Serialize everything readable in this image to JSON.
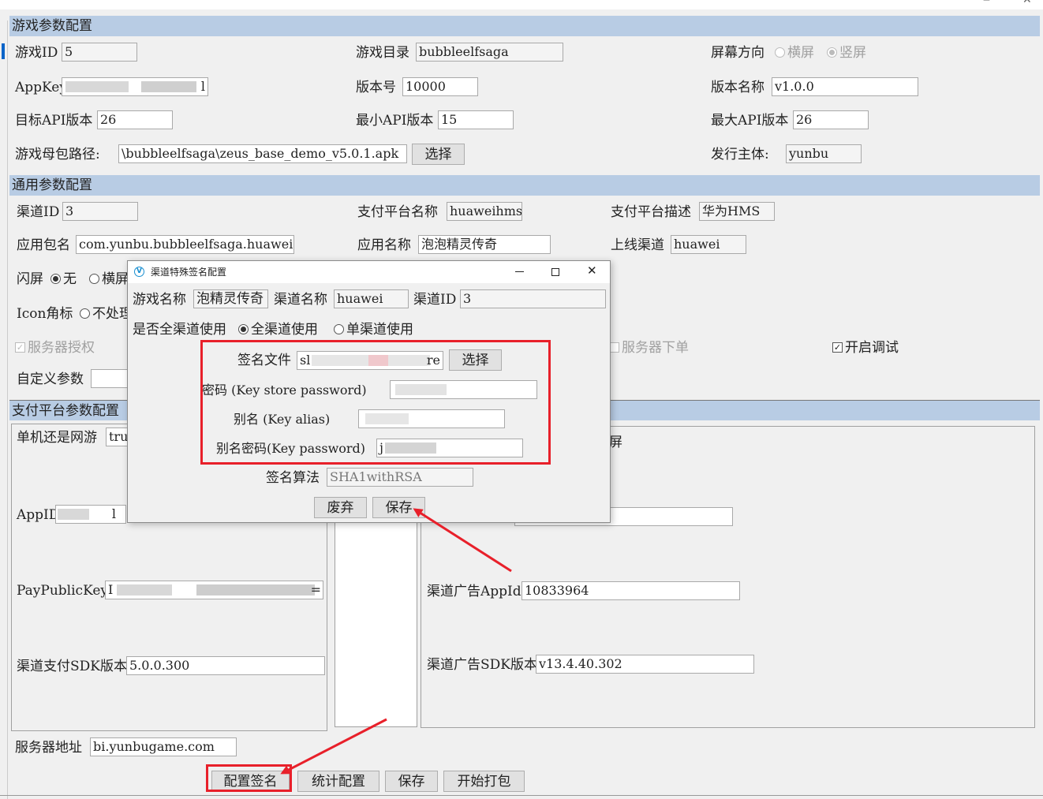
{
  "game_params": {
    "section_title": "游戏参数配置",
    "game_id_label": "游戏ID",
    "game_id": "5",
    "game_dir_label": "游戏目录",
    "game_dir": "bubbleelfsaga",
    "orientation_label": "屏幕方向",
    "orientation_landscape": "横屏",
    "orientation_portrait": "竖屏",
    "appkey_label": "AppKey",
    "appkey_tail": "l",
    "version_code_label": "版本号",
    "version_code": "10000",
    "version_name_label": "版本名称",
    "version_name": "v1.0.0",
    "target_api_label": "目标API版本",
    "target_api": "26",
    "min_api_label": "最小API版本",
    "min_api": "15",
    "max_api_label": "最大API版本",
    "max_api": "26",
    "apk_path_label": "游戏母包路径:",
    "apk_path": "\\bubbleelfsaga\\zeus_base_demo_v5.0.1.apk",
    "choose_label": "选择",
    "publisher_label": "发行主体:",
    "publisher": "yunbu"
  },
  "common_params": {
    "section_title": "通用参数配置",
    "channel_id_label": "渠道ID",
    "channel_id": "3",
    "pay_platform_name_label": "支付平台名称",
    "pay_platform_name": "huaweihms",
    "pay_platform_desc_label": "支付平台描述",
    "pay_platform_desc": "华为HMS",
    "package_label": "应用包名",
    "package": "com.yunbu.bubbleelfsaga.huawei",
    "app_name_label": "应用名称",
    "app_name": "泡泡精灵传奇",
    "online_channel_label": "上线渠道",
    "online_channel": "huawei",
    "splash_label": "闪屏",
    "splash_none": "无",
    "splash_landscape": "横屏",
    "icon_badge_label": "Icon角标",
    "icon_badge_opt": "不处理",
    "server_auth_label": "服务器授权",
    "server_order_label": "服务器下单",
    "debug_label": "开启调试",
    "custom_params_label": "自定义参数"
  },
  "pay_params": {
    "section_title": "支付平台参数配置",
    "single_or_online_label": "单机还是网游",
    "single_or_online": "tru",
    "appid_label": "AppID",
    "appid_tail": "l",
    "pay_public_key_label": "PayPublicKey",
    "pay_public_key_head": "I",
    "pay_public_key_tail": "=",
    "pay_sdk_version_label": "渠道支付SDK版本",
    "pay_sdk_version": "5.0.0.300",
    "ad_screen_tail": "屏",
    "ad_appid_label": "渠道广告AppId",
    "ad_appid": "10833964",
    "ad_sdk_version_label": "渠道广告SDK版本",
    "ad_sdk_version": "v13.4.40.302"
  },
  "footer": {
    "server_addr_label": "服务器地址",
    "server_addr": "bi.yunbugame.com",
    "config_sign_button": "配置签名",
    "stats_config_button": "统计配置",
    "save_button": "保存",
    "start_pack_button": "开始打包"
  },
  "dialog": {
    "title": "渠道特殊签名配置",
    "game_name_label": "游戏名称",
    "game_name": "泡精灵传奇",
    "channel_name_label": "渠道名称",
    "channel_name": "huawei",
    "channel_id_label": "渠道ID",
    "channel_id": "3",
    "scope_label": "是否全渠道使用",
    "scope_all": "全渠道使用",
    "scope_single": "单渠道使用",
    "sign_file_label": "签名文件",
    "sign_file_head": "sl",
    "sign_file_tail": "re",
    "choose_label": "选择",
    "store_pwd_label": "密码 (Key store password)",
    "alias_label": "别名 (Key alias)",
    "alias_pwd_label": "别名密码(Key password)",
    "alias_pwd_head": "j",
    "algo_label": "签名算法",
    "algo": "SHA1withRSA",
    "discard_button": "废弃",
    "save_button": "保存"
  },
  "annotation_color": "#e8202a",
  "header_band_color": "#b8cce4"
}
